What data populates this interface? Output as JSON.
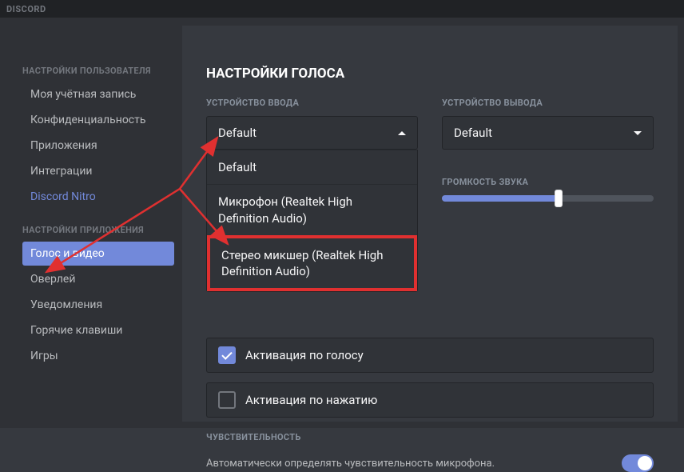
{
  "app": {
    "name": "DISCORD"
  },
  "sidebar": {
    "user_header": "НАСТРОЙКИ ПОЛЬЗОВАТЕЛЯ",
    "user_items": [
      "Моя учётная запись",
      "Конфиденциальность",
      "Приложения",
      "Интеграции",
      "Discord Nitro"
    ],
    "app_header": "НАСТРОЙКИ ПРИЛОЖЕНИЯ",
    "app_items": [
      "Голос и видео",
      "Оверлей",
      "Уведомления",
      "Горячие клавиши",
      "Игры"
    ],
    "active": "Голос и видео"
  },
  "main": {
    "title": "НАСТРОЙКИ ГОЛОСА",
    "input_label": "УСТРОЙСТВО ВВОДА",
    "output_label": "УСТРОЙСТВО ВЫВОДА",
    "input_selected": "Default",
    "output_selected": "Default",
    "input_options": [
      "Default",
      "Микрофон (Realtek High Definition Audio)",
      "Стерео микшер (Realtek High Definition Audio)"
    ],
    "output_volume_label": "ГРОМКОСТЬ ЗВУКА",
    "output_volume_percent": 55,
    "activation_voice": "Активация по голосу",
    "activation_voice_checked": true,
    "activation_push": "Активация по нажатию",
    "activation_push_checked": false,
    "sensitivity_label": "ЧУВСТВИТЕЛЬНОСТЬ",
    "sensitivity_text": "Автоматически определять чувствительность микрофона.",
    "sensitivity_toggle": true
  },
  "annotation": {
    "arrow_color": "#e03030"
  }
}
